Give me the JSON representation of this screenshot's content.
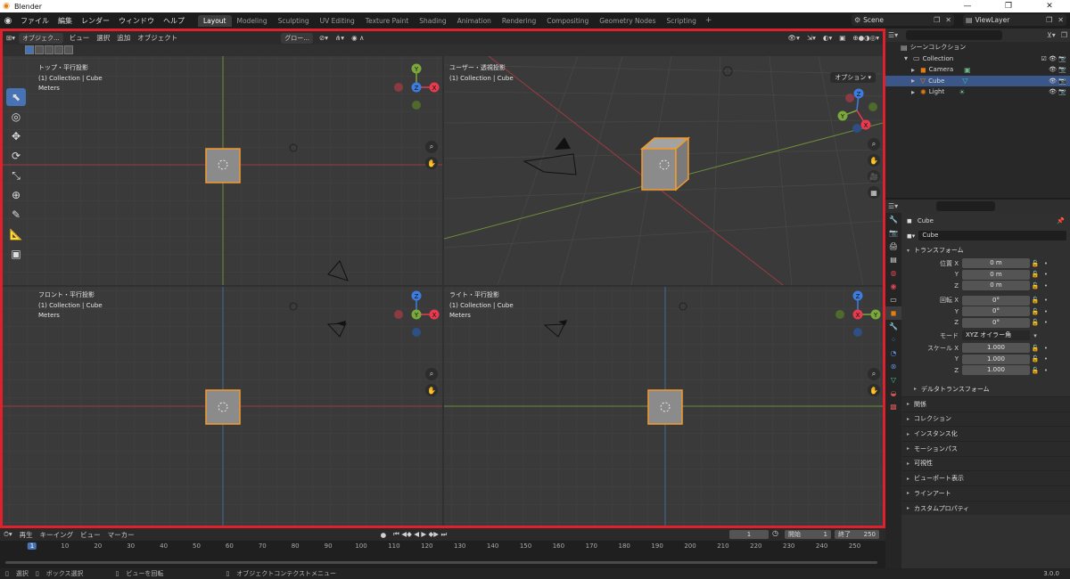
{
  "window": {
    "title": "Blender",
    "minimize": "—",
    "maximize": "❐",
    "close": "✕"
  },
  "menus": [
    "ファイル",
    "編集",
    "レンダー",
    "ウィンドウ",
    "ヘルプ"
  ],
  "workspaces": [
    {
      "label": "Layout",
      "active": true
    },
    {
      "label": "Modeling"
    },
    {
      "label": "Sculpting"
    },
    {
      "label": "UV Editing"
    },
    {
      "label": "Texture Paint"
    },
    {
      "label": "Shading"
    },
    {
      "label": "Animation"
    },
    {
      "label": "Rendering"
    },
    {
      "label": "Compositing"
    },
    {
      "label": "Geometry Nodes"
    },
    {
      "label": "Scripting"
    }
  ],
  "add_workspace": "+",
  "scene": {
    "name": "Scene"
  },
  "view_layer": {
    "name": "ViewLayer"
  },
  "viewport_header": {
    "mode": "オブジェク...",
    "menus": [
      "ビュー",
      "選択",
      "追加",
      "オブジェクト"
    ],
    "transform_orientation": "グロー...",
    "options": "オプション"
  },
  "viewports": [
    {
      "id": "top",
      "name": "トップ・平行投影",
      "collection": "(1) Collection | Cube",
      "units": "Meters"
    },
    {
      "id": "user",
      "name": "ユーザー・透視投影",
      "collection": "(1) Collection | Cube"
    },
    {
      "id": "front",
      "name": "フロント・平行投影",
      "collection": "(1) Collection | Cube",
      "units": "Meters"
    },
    {
      "id": "right",
      "name": "ライト・平行投影",
      "collection": "(1) Collection | Cube",
      "units": "Meters"
    }
  ],
  "axes": {
    "x": "X",
    "y": "Y",
    "z": "Z"
  },
  "axis_colors": {
    "x": "#e83a4f",
    "y": "#7aa83a",
    "z": "#3d7ce0",
    "neg_x": "#8a3a42",
    "neg_y": "#4f6a2c",
    "neg_z": "#2e4f84"
  },
  "outliner": {
    "root": "シーンコレクション",
    "items": [
      {
        "label": "Collection",
        "indent": 1
      },
      {
        "label": "Camera",
        "indent": 2
      },
      {
        "label": "Cube",
        "indent": 2,
        "selected": true
      },
      {
        "label": "Light",
        "indent": 2
      }
    ]
  },
  "properties": {
    "object_name": "Cube",
    "object_field": "Cube",
    "transform_title": "トランスフォーム",
    "location": {
      "label": "位置 X",
      "x": "0 m",
      "y": "0 m",
      "z": "0 m"
    },
    "rotation": {
      "label": "回転 X",
      "x": "0°",
      "y": "0°",
      "z": "0°"
    },
    "mode": {
      "label": "モード",
      "value": "XYZ オイラー角"
    },
    "scale": {
      "label": "スケール X",
      "x": "1.000",
      "y": "1.000",
      "z": "1.000"
    },
    "axis_labels": {
      "y": "Y",
      "z": "Z"
    },
    "delta": "デルタトランスフォーム",
    "panels": [
      "関係",
      "コレクション",
      "インスタンス化",
      "モーションパス",
      "可視性",
      "ビューポート表示",
      "ラインアート",
      "カスタムプロパティ"
    ]
  },
  "timeline": {
    "menus": [
      "再生",
      "キーイング",
      "ビュー",
      "マーカー"
    ],
    "current_frame": "1",
    "start_label": "開始",
    "start": "1",
    "end_label": "終了",
    "end": "250",
    "ruler": [
      "1",
      "10",
      "20",
      "30",
      "40",
      "50",
      "60",
      "70",
      "80",
      "90",
      "100",
      "110",
      "120",
      "130",
      "140",
      "150",
      "160",
      "170",
      "180",
      "190",
      "200",
      "210",
      "220",
      "230",
      "240",
      "250"
    ]
  },
  "statusbar": {
    "select": "選択",
    "box_select": "ボックス選択",
    "rotate_view": "ビューを回転",
    "context_menu": "オブジェクトコンテクストメニュー",
    "version": "3.0.0"
  }
}
